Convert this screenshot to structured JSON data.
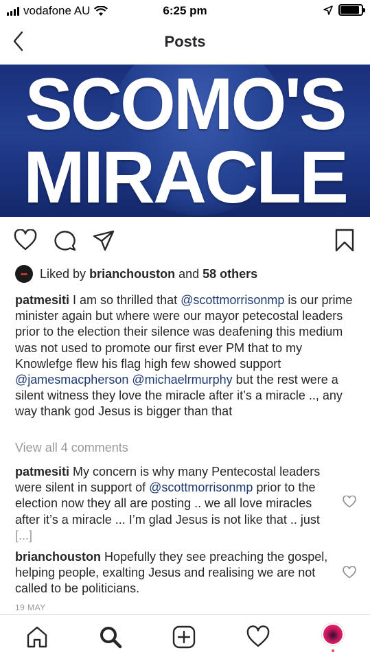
{
  "status_bar": {
    "carrier": "vodafone AU",
    "time": "6:25 pm",
    "battery_level": 0.9,
    "icons": [
      "signal-icon",
      "wifi-icon",
      "location-arrow-icon",
      "battery-icon"
    ]
  },
  "nav": {
    "back_icon": "chevron-left-icon",
    "title": "Posts"
  },
  "post_image": {
    "headline_line1": "SCOMO'S",
    "headline_line2": "MIRACLE",
    "background_color": "#1b3380"
  },
  "actions": {
    "icons": [
      "heart-icon",
      "comment-icon",
      "share-icon",
      "bookmark-icon"
    ]
  },
  "likes": {
    "prefix": "Liked by",
    "user": "brianchouston",
    "middle": "and",
    "others": "58 others"
  },
  "caption": {
    "username": "patmesiti",
    "text1": " I am so thrilled that ",
    "mention1": "@scottmorrisonmp",
    "text2": " is our prime minister again but where were our mayor petecostal leaders prior to the election their silence was deafening this medium was not used to promote our first ever PM that to my Knowlefge flew his flag high few showed support ",
    "mention2": "@jamesmacpherson",
    "text3": " ",
    "mention3": "@michaelrmurphy",
    "text4": " but the rest were a silent witness they love the miracle after it’s a miracle .., any way thank god Jesus is bigger than that"
  },
  "view_comments": "View all 4 comments",
  "comments": [
    {
      "username": "patmesiti",
      "text1": " My concern is why many Pentecostal leaders were silent in support of ",
      "mention": "@scottmorrisonmp",
      "text2": " prior to the election now they all are posting .. we all love miracles after it’s a miracle ... I’m glad Jesus is not like that .. just ",
      "more": "[...]"
    },
    {
      "username": "brianchouston",
      "text": " Hopefully they see preaching the gospel, helping people, exalting Jesus and realising we are not called to be politicians."
    }
  ],
  "date": "19 MAY",
  "tab_bar": {
    "icons": [
      "home-icon",
      "search-icon",
      "new-post-icon",
      "activity-heart-icon",
      "profile-avatar"
    ],
    "accent": "#ed4956"
  }
}
